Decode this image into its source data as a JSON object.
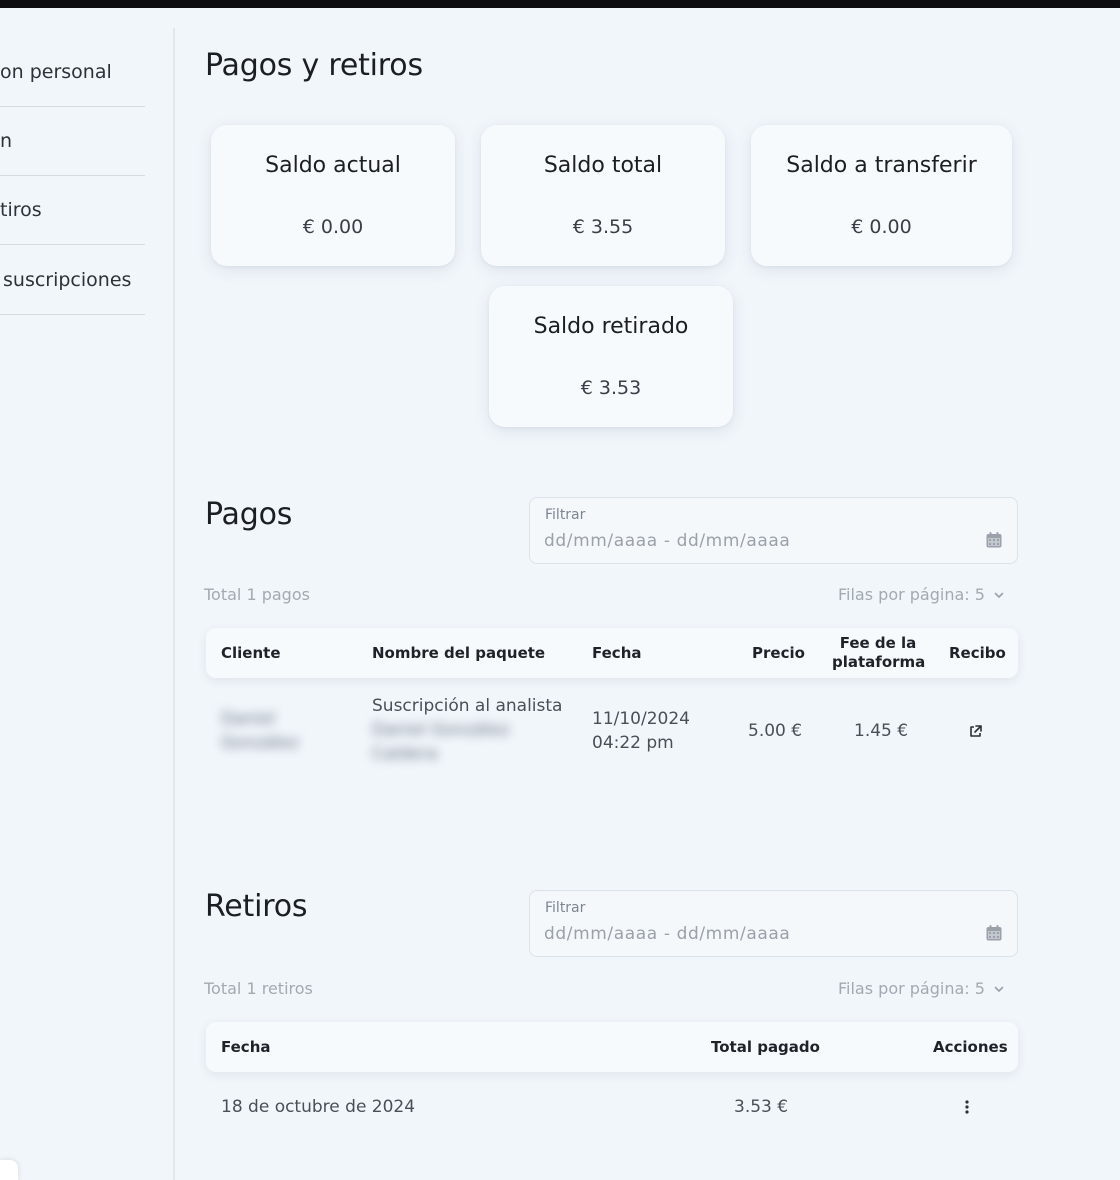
{
  "sidebar": {
    "items": [
      {
        "label": "on personal"
      },
      {
        "label": "n"
      },
      {
        "label": "tiros"
      },
      {
        "label": "suscripciones"
      }
    ]
  },
  "page": {
    "title": "Pagos y retiros"
  },
  "balances": [
    {
      "title": "Saldo actual",
      "value": "€ 0.00"
    },
    {
      "title": "Saldo total",
      "value": "€ 3.55"
    },
    {
      "title": "Saldo a transferir",
      "value": "€ 0.00"
    },
    {
      "title": "Saldo retirado",
      "value": "€ 3.53"
    }
  ],
  "payments": {
    "title": "Pagos",
    "filter_label": "Filtrar",
    "filter_placeholder": "dd/mm/aaaa - dd/mm/aaaa",
    "total": "Total 1 pagos",
    "rows_per_page": "Filas por página: 5",
    "columns": {
      "client": "Cliente",
      "package": "Nombre del paquete",
      "date": "Fecha",
      "price": "Precio",
      "fee_line1": "Fee de la",
      "fee_line2": "plataforma",
      "receipt": "Recibo"
    },
    "rows": [
      {
        "client_line1": "Daniel",
        "client_line2": "González",
        "package_line1": "Suscripción al analista",
        "package_line2": "Daniel González",
        "package_line3": "Caldera",
        "date_line1": "11/10/2024",
        "date_line2": "04:22 pm",
        "price": "5.00 €",
        "fee": "1.45 €",
        "receipt_icon": "external-link-icon"
      }
    ]
  },
  "withdrawals": {
    "title": "Retiros",
    "filter_label": "Filtrar",
    "filter_placeholder": "dd/mm/aaaa - dd/mm/aaaa",
    "total": "Total 1 retiros",
    "rows_per_page": "Filas por página: 5",
    "columns": {
      "date": "Fecha",
      "total_paid": "Total pagado",
      "actions": "Acciones"
    },
    "rows": [
      {
        "date": "18 de octubre de 2024",
        "total_paid": "3.53 €",
        "actions_icon": "kebab-menu-icon"
      }
    ]
  }
}
